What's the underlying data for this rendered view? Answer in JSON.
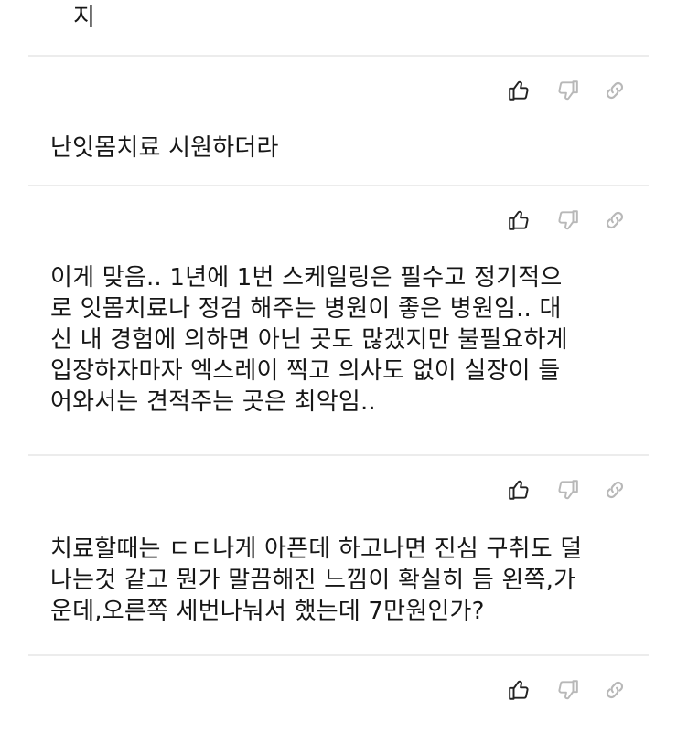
{
  "comments": [
    {
      "text": "지"
    },
    {
      "text": "난잇몸치료 시원하더라"
    },
    {
      "text": "이게 맞음.. 1년에 1번 스케일링은 필수고 정기적으\n로 잇몸치료나 정검 해주는 병원이 좋은 병원임.. 대\n신 내 경험에 의하면 아닌 곳도 많겠지만 불필요하게\n입장하자마자 엑스레이 찍고 의사도 없이 실장이 들\n어와서는 견적주는 곳은 최악임.."
    },
    {
      "text": "치료할때는 ㄷㄷ나게 아픈데 하고나면 진심 구취도 덜\n나는것 같고 뭔가 말끔해진 느낌이 확실히 듬 왼쪽,가\n운데,오른쪽 세번나눠서 했는데 7만원인가?"
    }
  ],
  "icons": {
    "like": "thumbs-up-icon",
    "dislike": "thumbs-down-icon",
    "share": "link-icon"
  },
  "colors": {
    "like_icon": "#222222",
    "dislike_icon": "#b8b8b8",
    "share_icon": "#b8b8b8",
    "divider": "#ececec"
  }
}
